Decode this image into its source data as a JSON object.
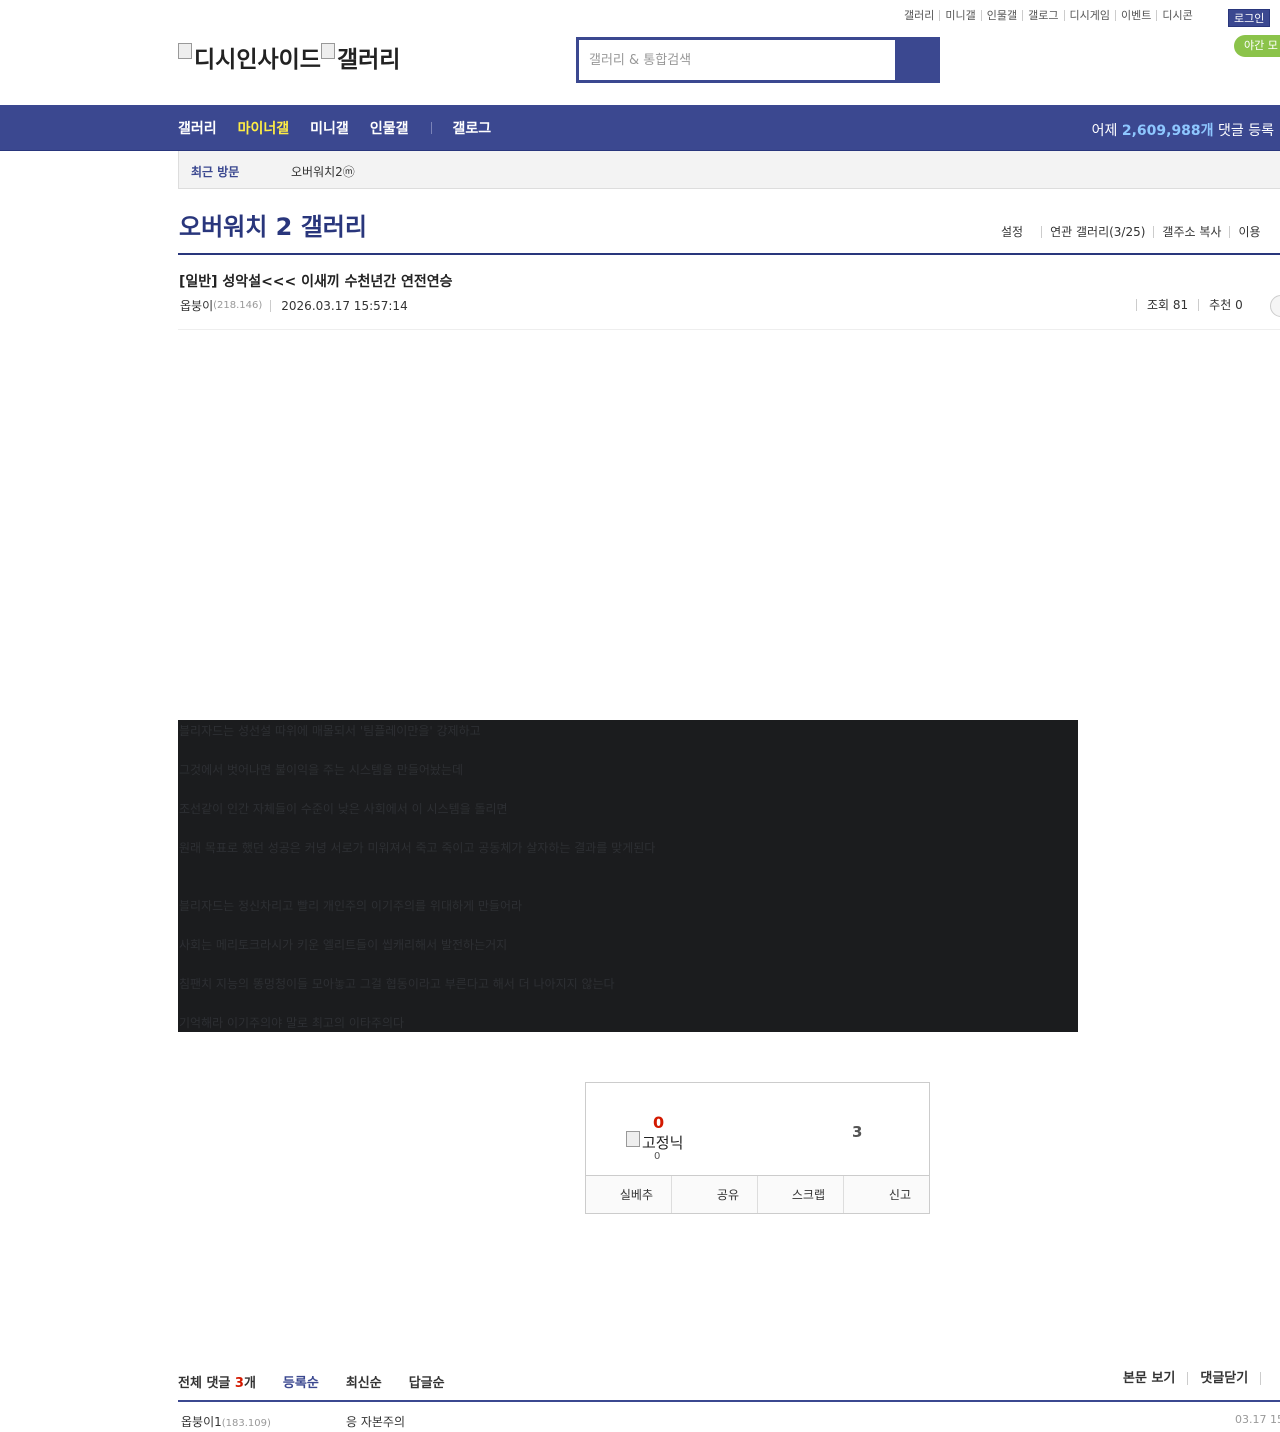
{
  "util_links": [
    "갤러리",
    "미니갤",
    "인물갤",
    "갤로그",
    "디시게임",
    "이벤트",
    "디시콘"
  ],
  "login_label": "로그인",
  "night_mode_label": "야간 모",
  "logo": {
    "alt_main": "디시인사이드",
    "alt_sub": "갤러리"
  },
  "search": {
    "placeholder": "갤러리 & 통합검색"
  },
  "gnb": {
    "items": [
      "갤러리",
      "마이너갤",
      "미니갤",
      "인물갤"
    ],
    "extra": "갤로그",
    "yesterday_prefix": "어제",
    "yesterday_count": "2,609,988개",
    "yesterday_suffix": "댓글 등록"
  },
  "recent": {
    "label": "최근 방문",
    "item": "오버워치2ⓜ"
  },
  "gallery": {
    "title": "오버워치 2 갤러리",
    "links": [
      "설정",
      "연관 갤러리(3/25)",
      "갤주소 복사",
      "이용"
    ]
  },
  "post": {
    "subject": "[일반] 성악설<<< 이새끼 수천년간 연전연승",
    "author": "옵붕이",
    "author_ip": "(218.146)",
    "date": "2026.03.17 15:57:14",
    "views": "조회 81",
    "recommend": "추천 0",
    "body": [
      "블리자드는 성선설 따위에 매몰되서 '팀플레이만을' 강제하고",
      "그것에서 벗어나면 불이익을 주는 시스템을 만들어놨는데",
      "조선같이 인간 자체들이 수준이 낮은 사회에서 이 시스템을 돌리면",
      "원래 목표로 했던 성공은 커녕 서로가 미워져서 죽고 죽이고 공동체가 살자하는 결과를 맞게된다",
      "블리자드는 정신차리고 빨리 개인주의 이기주의를 위대하게 만들어라",
      "사회는 메리토크라시가 키운 엘리트들이 씹캐리해서 발전하는거지",
      "침팬치 지능의 똥멍청이들 모아놓고 그걸 협동이라고 부른다고 해서 더 나아지지 않는다",
      "기억해라 이기주의야 말로 최고의 이타주의다"
    ]
  },
  "recommend_box": {
    "up_count": "0",
    "fixed_alt": "고정닉",
    "fixed_count": "0",
    "down_count": "3",
    "buttons": [
      "실베추",
      "공유",
      "스크랩",
      "신고"
    ]
  },
  "comments": {
    "total_label": "전체 댓글",
    "total_count": "3",
    "total_unit": "개",
    "sorts": [
      "등록순",
      "최신순",
      "답글순"
    ],
    "right_links": [
      "본문 보기",
      "댓글닫기"
    ],
    "items": [
      {
        "nick": "옵붕이1",
        "ip": "(183.109)",
        "text": "응 자본주의",
        "time": "03.17 15"
      }
    ]
  },
  "colors": {
    "primary": "#3b4890",
    "highlight": "#ffed44",
    "count_blue": "#8ec7ff",
    "red": "#d31900",
    "night_green": "#8bc34a",
    "content_bg": "#1b1c1e"
  }
}
